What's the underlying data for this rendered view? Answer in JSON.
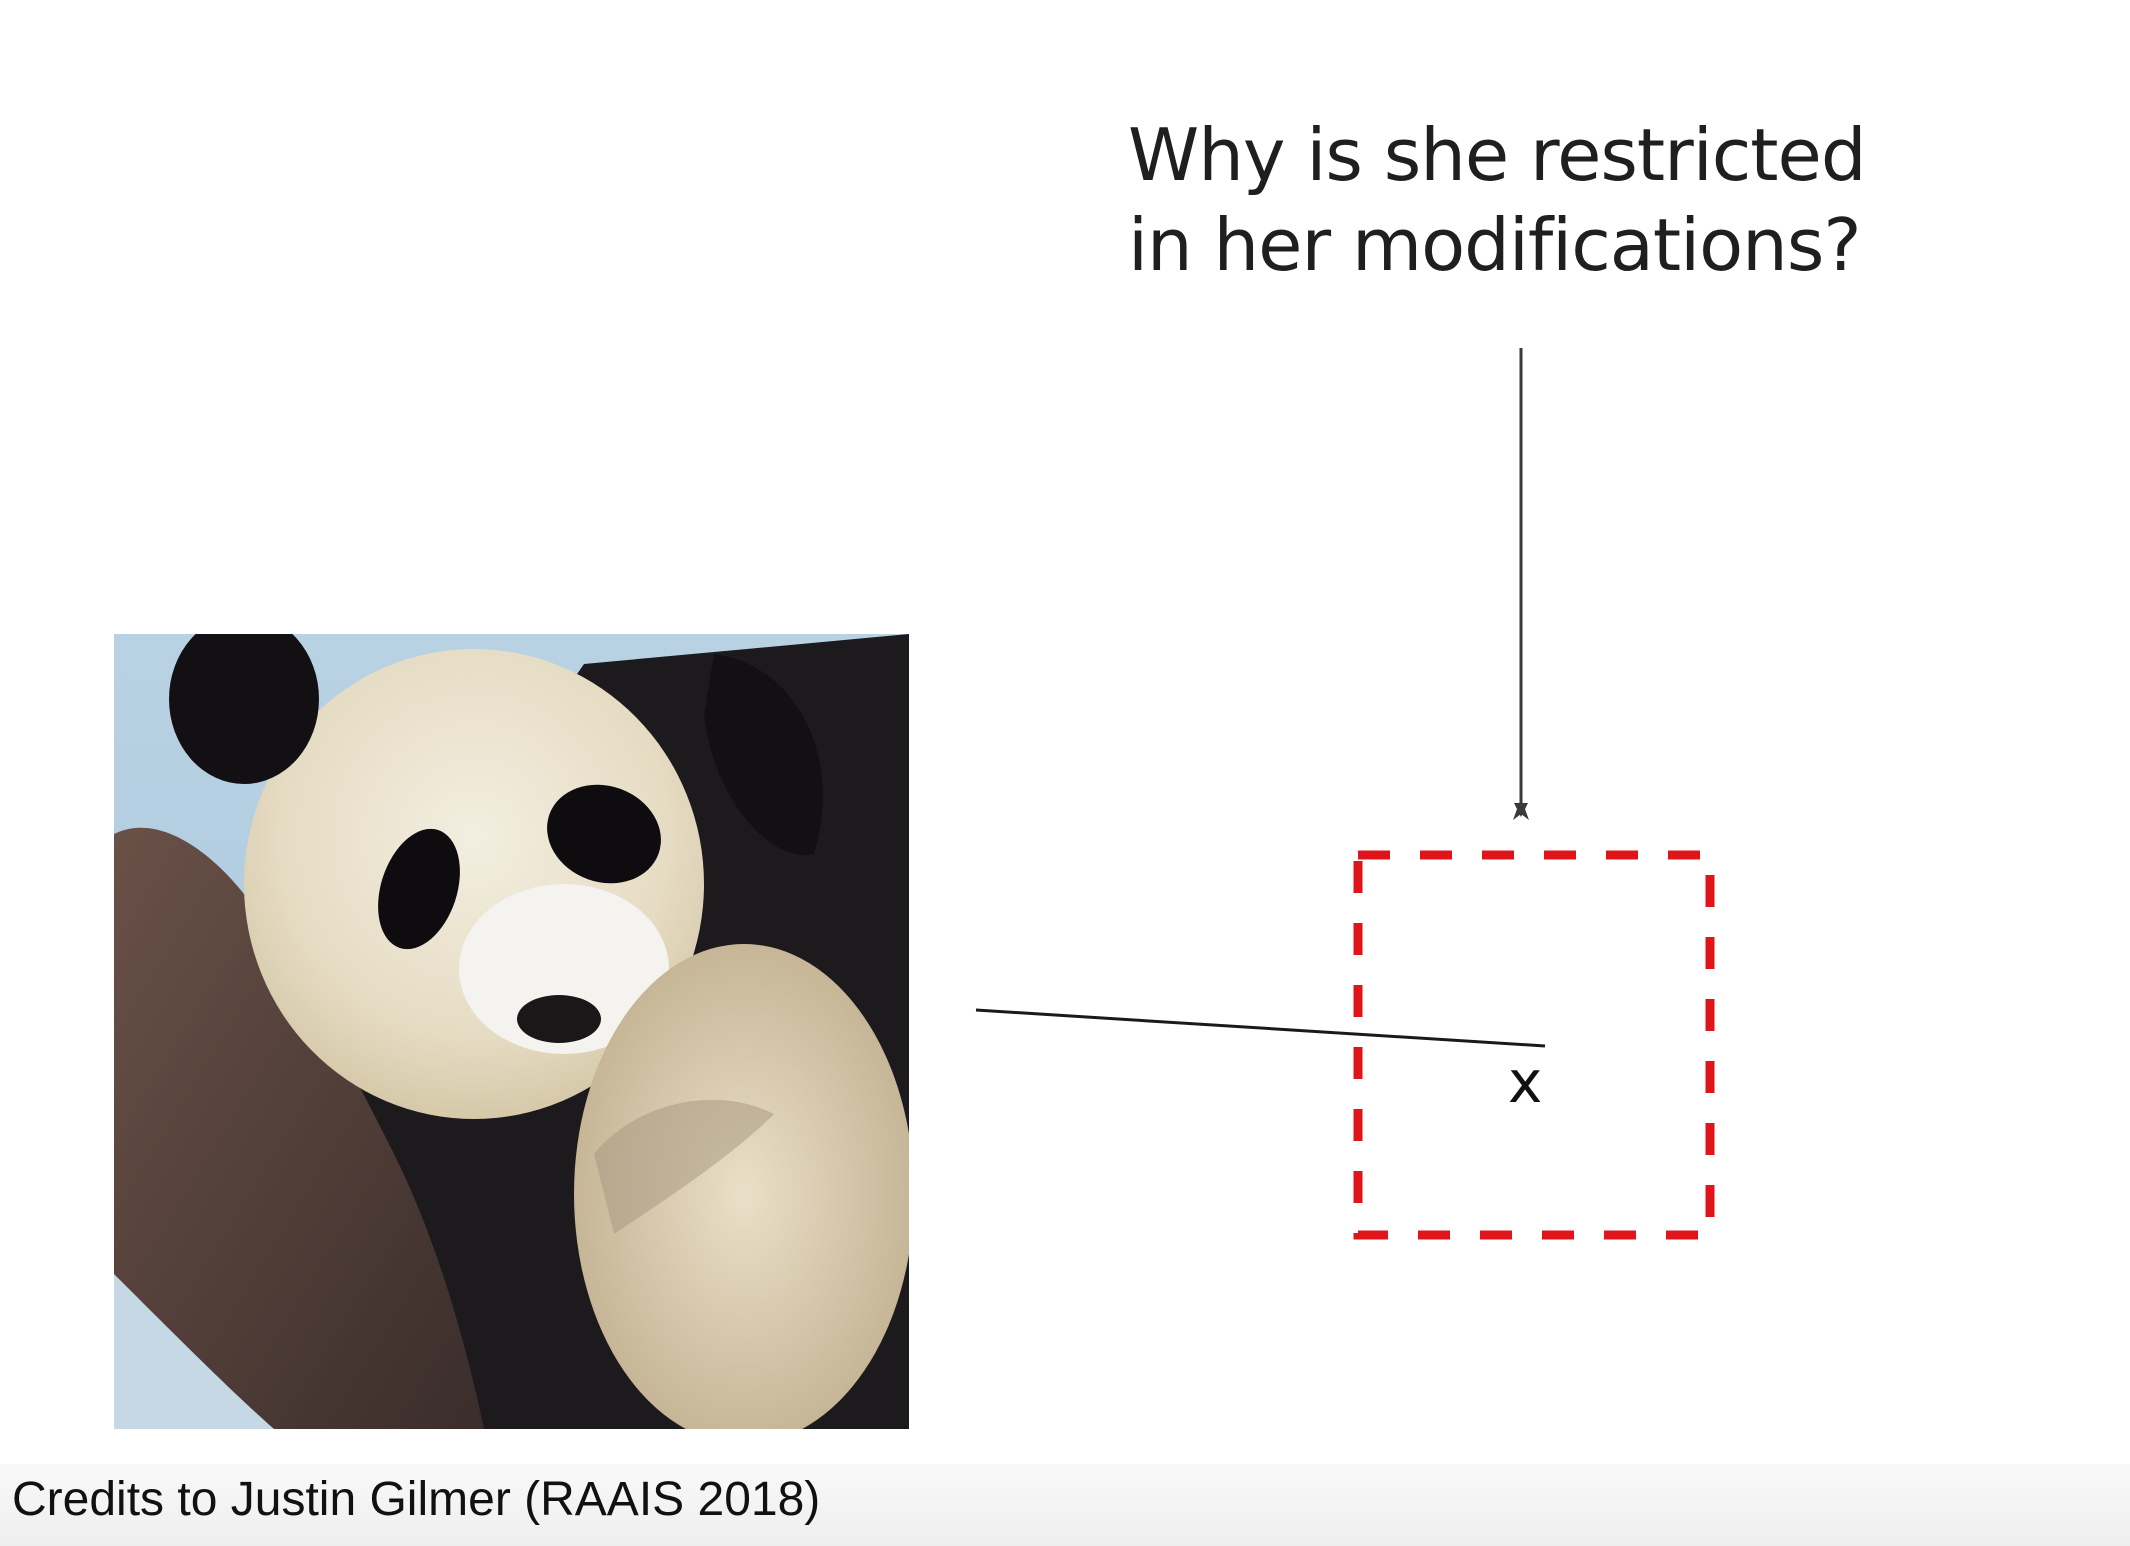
{
  "question": {
    "line1": "Why is she restricted",
    "line2": "in her modifications?"
  },
  "point_label": "x",
  "credit": "Credits to Justin Gilmer (RAAIS 2018)",
  "colors": {
    "constraint_box": "#e0141b",
    "arrow": "#3a3a3a",
    "text": "#1f1f1f"
  },
  "icons": {
    "image": "panda-photo",
    "arrow": "arrow-down",
    "region": "dashed-square"
  }
}
